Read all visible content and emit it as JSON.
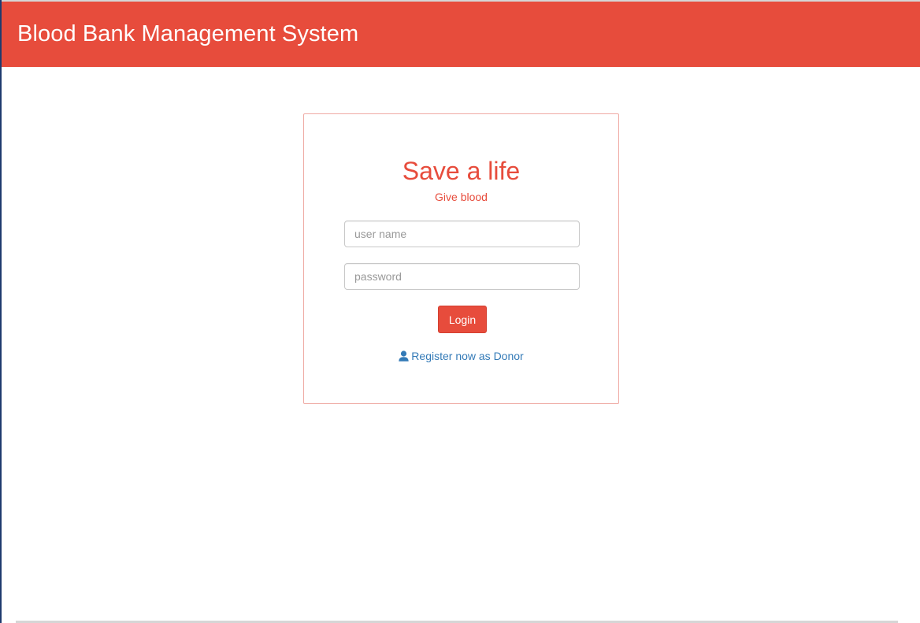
{
  "header": {
    "title": "Blood Bank Management System"
  },
  "login": {
    "heading": "Save a life",
    "subheading": "Give blood",
    "username_placeholder": "user name",
    "username_value": "",
    "password_placeholder": "password",
    "password_value": "",
    "submit_label": "Login",
    "register_icon": "user-icon",
    "register_label": "Register now as Donor"
  },
  "colors": {
    "brand_red": "#e74c3c",
    "link_blue": "#337ab7",
    "card_border": "#efaaa4"
  }
}
